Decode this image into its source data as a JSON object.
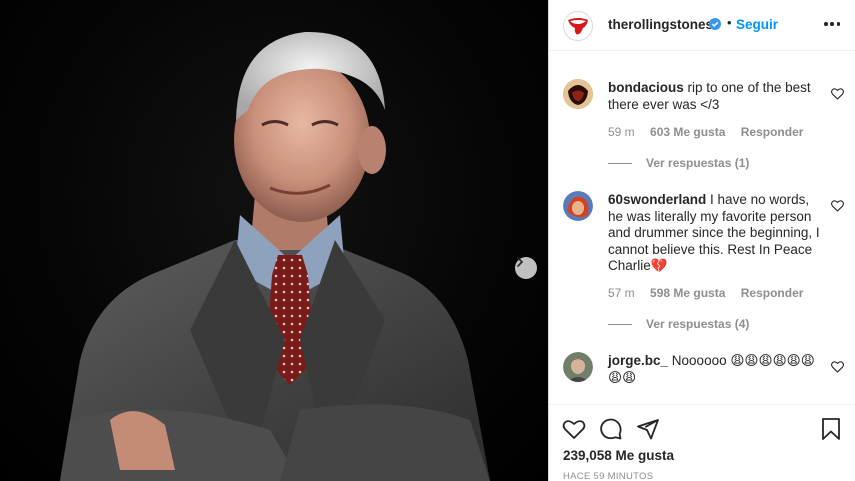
{
  "post": {
    "username": "therollingstones",
    "follow_label": "Seguir",
    "separator": "•",
    "likes": "239,058 Me gusta",
    "time_ago": "HACE 59 MINUTOS"
  },
  "comments": [
    {
      "user": "bondacious",
      "text": "rip to one of the best there ever was </3",
      "time": "59 m",
      "likes": "603 Me gusta",
      "reply_label": "Responder",
      "view_replies": "Ver respuestas (1)"
    },
    {
      "user": "60swonderland",
      "text": "I have no words, he was literally my favorite person and drummer since the beginning, I cannot believe this. Rest In Peace Charlie💔",
      "time": "57 m",
      "likes": "598 Me gusta",
      "reply_label": "Responder",
      "view_replies": "Ver respuestas (4)"
    },
    {
      "user": "jorge.bc_",
      "text": "Noooooo 😩😩😩😩😩😩😩😩"
    }
  ],
  "icons": {
    "logo": "rolling-stones-tongue-logo",
    "verified": "verified-badge-icon",
    "more": "more-options-icon",
    "like": "heart-icon",
    "comment": "comment-icon",
    "share": "share-icon",
    "save": "bookmark-icon",
    "next": "chevron-right-icon"
  },
  "colors": {
    "link": "#0095f6",
    "muted": "#8e8e8e",
    "text": "#262626",
    "border": "#dbdbdb"
  }
}
